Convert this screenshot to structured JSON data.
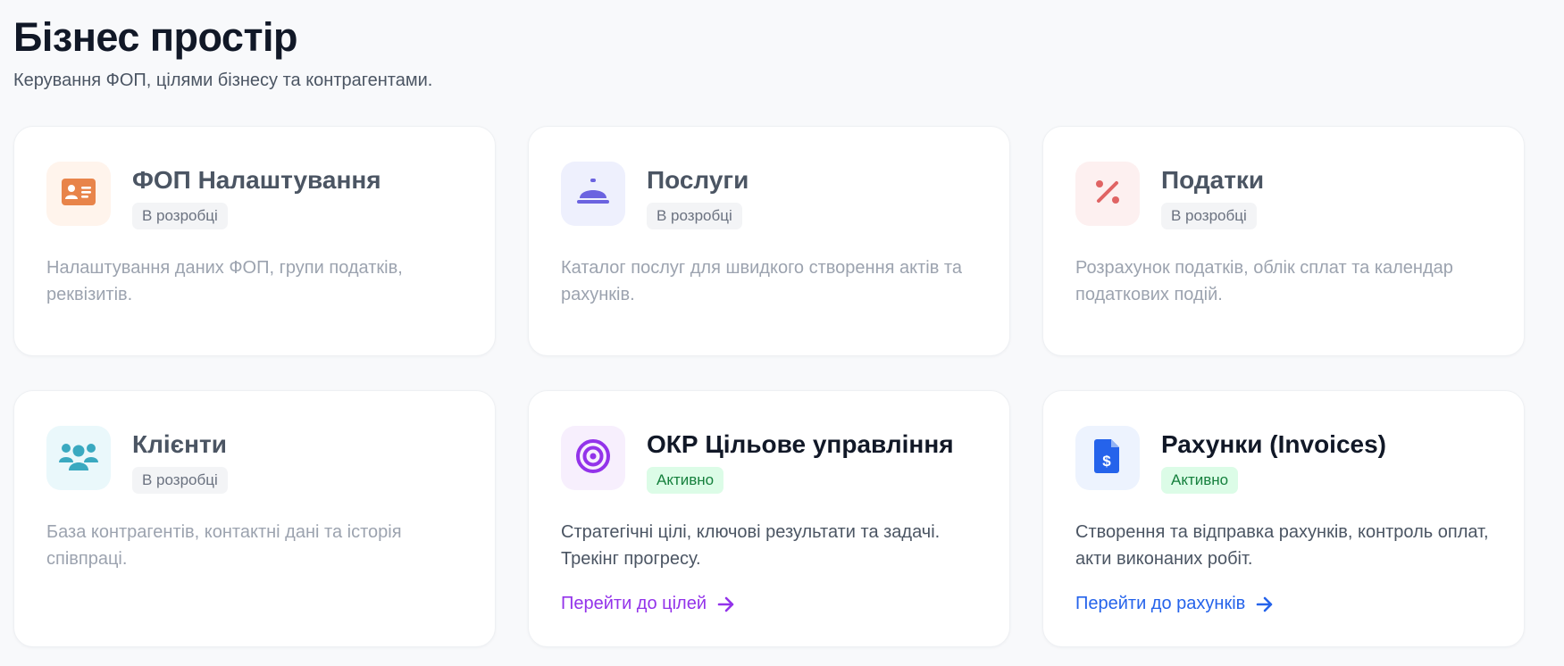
{
  "page": {
    "title": "Бізнес простір",
    "subtitle": "Керування ФОП, цілями бізнесу та контрагентами."
  },
  "cards": [
    {
      "title": "ФОП Налаштування",
      "status": "В розробці",
      "description": "Налаштування даних ФОП, групи податків, реквізитів.",
      "icon": "id-card-icon",
      "accent": "#e8844a"
    },
    {
      "title": "Послуги",
      "status": "В розробці",
      "description": "Каталог послуг для швидкого створення актів та рахунків.",
      "icon": "service-bell-icon",
      "accent": "#6b63e0"
    },
    {
      "title": "Податки",
      "status": "В розробці",
      "description": "Розрахунок податків, облік сплат та календар податкових подій.",
      "icon": "percent-icon",
      "accent": "#e06464"
    },
    {
      "title": "Клієнти",
      "status": "В розробці",
      "description": "База контрагентів, контактні дані та історія співпраці.",
      "icon": "users-icon",
      "accent": "#3aa9c0"
    },
    {
      "title": "ОКР Цільове управління",
      "status": "Активно",
      "description": "Стратегічні цілі, ключові результати та задачі. Трекінг прогресу.",
      "link": "Перейти до цілей",
      "icon": "target-icon",
      "accent": "#9333ea"
    },
    {
      "title": "Рахунки (Invoices)",
      "status": "Активно",
      "description": "Створення та відправка рахунків, контроль оплат, акти виконаних робіт.",
      "link": "Перейти до рахунків",
      "icon": "invoice-dollar-icon",
      "accent": "#2563eb"
    }
  ]
}
